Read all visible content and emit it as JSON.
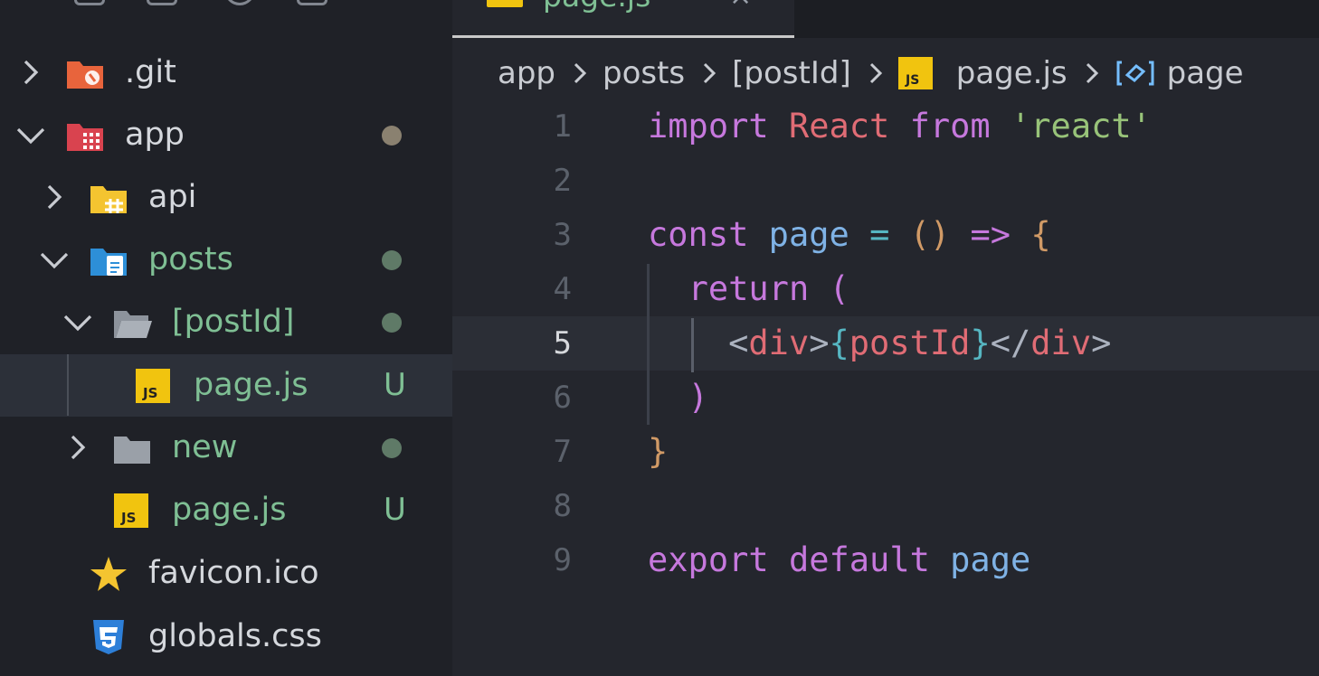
{
  "explorer": {
    "items": [
      {
        "label": ".git",
        "icon": "git-folder-icon",
        "chevron": "right",
        "status": null
      },
      {
        "label": "app",
        "icon": "app-folder-icon",
        "chevron": "down",
        "status": "dot"
      },
      {
        "label": "api",
        "icon": "api-folder-icon",
        "chevron": "right",
        "status": null
      },
      {
        "label": "posts",
        "icon": "posts-folder-icon",
        "chevron": "down",
        "status": "dot"
      },
      {
        "label": "[postId]",
        "icon": "folder-open-icon",
        "chevron": "down",
        "status": "dot"
      },
      {
        "label": "page.js",
        "icon": "js-file-icon",
        "chevron": null,
        "status": "U"
      },
      {
        "label": "new",
        "icon": "folder-icon",
        "chevron": "right",
        "status": "dot"
      },
      {
        "label": "page.js",
        "icon": "js-file-icon",
        "chevron": null,
        "status": "U"
      },
      {
        "label": "favicon.ico",
        "icon": "star-icon",
        "chevron": null,
        "status": null
      },
      {
        "label": "globals.css",
        "icon": "css-file-icon",
        "chevron": null,
        "status": null
      }
    ]
  },
  "editor": {
    "tab": {
      "label": "page.js"
    },
    "breadcrumb": [
      "app",
      "posts",
      "[postId]",
      "page.js",
      "page"
    ],
    "current_line": 5,
    "lines": [
      {
        "n": "1",
        "tokens": [
          [
            "import",
            "kw"
          ],
          [
            " ",
            ""
          ],
          [
            "React",
            "id-red"
          ],
          [
            " ",
            ""
          ],
          [
            "from",
            "kw"
          ],
          [
            " ",
            ""
          ],
          [
            "'react'",
            "str"
          ]
        ]
      },
      {
        "n": "2",
        "tokens": []
      },
      {
        "n": "3",
        "tokens": [
          [
            "const",
            "kw"
          ],
          [
            " ",
            ""
          ],
          [
            "page",
            "id-blue"
          ],
          [
            " ",
            ""
          ],
          [
            "=",
            "op"
          ],
          [
            " ",
            ""
          ],
          [
            "()",
            "paren"
          ],
          [
            " ",
            ""
          ],
          [
            "=>",
            "kw"
          ],
          [
            " ",
            ""
          ],
          [
            "{",
            "paren"
          ]
        ]
      },
      {
        "n": "4",
        "tokens": [
          [
            "  ",
            ""
          ],
          [
            "return",
            "kw"
          ],
          [
            " ",
            ""
          ],
          [
            "(",
            "paren2"
          ]
        ]
      },
      {
        "n": "5",
        "tokens": [
          [
            "    ",
            ""
          ],
          [
            "<",
            "tag-br"
          ],
          [
            "div",
            "tag"
          ],
          [
            ">",
            "tag-br"
          ],
          [
            "{",
            "jsx-br"
          ],
          [
            "postId",
            "id-red"
          ],
          [
            "}",
            "jsx-br"
          ],
          [
            "</",
            "tag-br"
          ],
          [
            "div",
            "tag"
          ],
          [
            ">",
            "tag-br"
          ]
        ]
      },
      {
        "n": "6",
        "tokens": [
          [
            "  ",
            ""
          ],
          [
            ")",
            "paren2"
          ]
        ]
      },
      {
        "n": "7",
        "tokens": [
          [
            "}",
            "paren"
          ]
        ]
      },
      {
        "n": "8",
        "tokens": []
      },
      {
        "n": "9",
        "tokens": [
          [
            "export",
            "kw"
          ],
          [
            " ",
            ""
          ],
          [
            "default",
            "kw"
          ],
          [
            " ",
            ""
          ],
          [
            "page",
            "id-blue"
          ]
        ]
      }
    ]
  },
  "colors": {
    "git_status_green": "#7fbf94",
    "modified_dot": "#8a8170",
    "untracked_dot": "#5f7a67",
    "js_yellow": "#f1c40f"
  }
}
